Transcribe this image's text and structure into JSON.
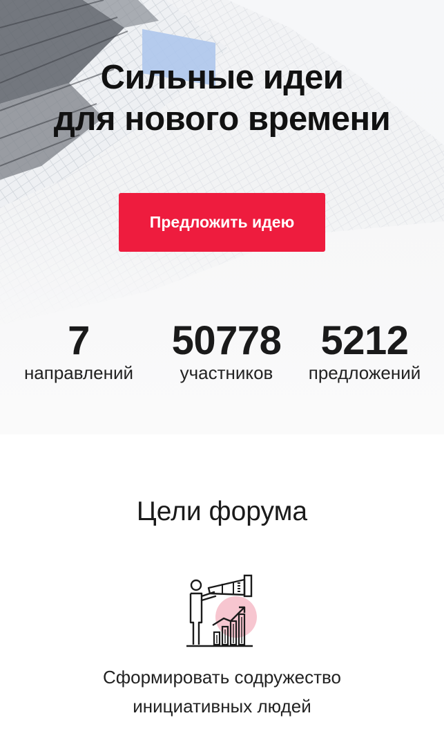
{
  "hero": {
    "title_line1": "Сильные идеи",
    "title_line2": "для нового времени",
    "cta_label": "Предложить идею"
  },
  "stats": [
    {
      "value": "7",
      "label": "направлений"
    },
    {
      "value": "50778",
      "label": "участников"
    },
    {
      "value": "5212",
      "label": "предложений"
    }
  ],
  "goals": {
    "title": "Цели форума",
    "items": [
      {
        "icon": "telescope-growth-chart-icon",
        "text_line1": "Сформировать содружество",
        "text_line2": "инициативных людей"
      }
    ]
  },
  "colors": {
    "accent": "#ee1c3e",
    "text": "#111111",
    "icon_highlight": "#f7c6d0",
    "background": "#ffffff"
  }
}
